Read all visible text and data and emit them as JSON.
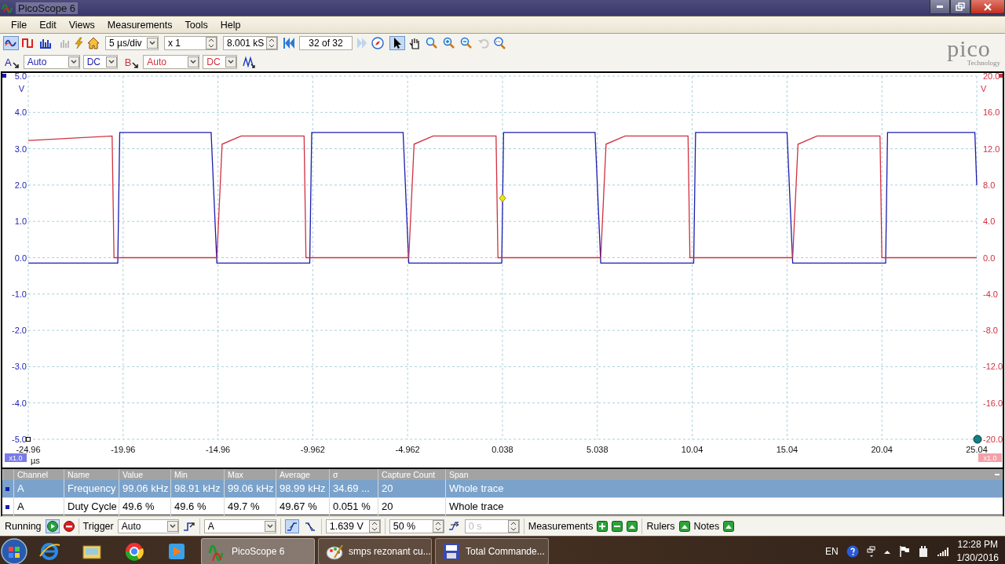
{
  "window": {
    "title": "PicoScope 6"
  },
  "menu": [
    {
      "label": "File"
    },
    {
      "label": "Edit"
    },
    {
      "label": "Views"
    },
    {
      "label": "Measurements"
    },
    {
      "label": "Tools"
    },
    {
      "label": "Help"
    }
  ],
  "toolbar": {
    "view_modes": [
      {
        "kind": "scope",
        "selected": true
      },
      {
        "kind": "persistence",
        "selected": false
      },
      {
        "kind": "spectrum",
        "selected": false
      }
    ],
    "timebase": "5 µs/div",
    "zoom": "x 1",
    "samples": "8.001 kS",
    "buffer": "32 of 32",
    "tools": [
      {
        "kind": "pointer",
        "selected": true
      },
      {
        "kind": "hand",
        "selected": false
      },
      {
        "kind": "zoom",
        "selected": false
      },
      {
        "kind": "zoom-in",
        "selected": false
      },
      {
        "kind": "zoom-out",
        "selected": false
      },
      {
        "kind": "undo",
        "selected": false
      }
    ]
  },
  "channels": [
    {
      "name": "A",
      "range": "Auto",
      "coupling": "DC",
      "color": "#1c1cb0"
    },
    {
      "name": "B",
      "range": "Auto",
      "coupling": "DC",
      "color": "#d03040"
    }
  ],
  "logo": {
    "name": "pico",
    "tagline": "Technology"
  },
  "scope": {
    "left_zoom": "x1.0",
    "right_zoom": "x1.0",
    "chart_data": {
      "type": "line",
      "xlabel": "µs",
      "ylabel": "V",
      "y2label": "V",
      "xlim": [
        -24.96,
        25.04
      ],
      "ylim": [
        -5,
        5
      ],
      "y2lim": [
        -20,
        20
      ],
      "xticks": [
        -24.96,
        -19.96,
        -14.96,
        -9.962,
        -4.962,
        0.038,
        5.038,
        10.04,
        15.04,
        20.04,
        25.04
      ],
      "yticks": [
        {
          "value": 5,
          "label": "5.0"
        },
        {
          "value": 4,
          "label": "4.0"
        },
        {
          "value": 3,
          "label": "3.0"
        },
        {
          "value": 2,
          "label": "2.0"
        },
        {
          "value": 1,
          "label": "1.0"
        },
        {
          "value": 0,
          "label": "0.0"
        },
        {
          "value": -1,
          "label": "-1.0"
        },
        {
          "value": -2,
          "label": "-2.0"
        },
        {
          "value": -3,
          "label": "-3.0"
        },
        {
          "value": -4,
          "label": "-4.0"
        },
        {
          "value": -5,
          "label": "-5.0"
        }
      ],
      "y2ticks": [
        {
          "value": 20,
          "label": "20.0"
        },
        {
          "value": 16,
          "label": "16.0"
        },
        {
          "value": 12,
          "label": "12.0"
        },
        {
          "value": 8,
          "label": "8.0"
        },
        {
          "value": 4,
          "label": "4.0"
        },
        {
          "value": 0,
          "label": "0.0"
        },
        {
          "value": -4,
          "label": "-4.0"
        },
        {
          "value": -8,
          "label": "-8.0"
        },
        {
          "value": -12,
          "label": "-12.0"
        },
        {
          "value": -16,
          "label": "-16.0"
        },
        {
          "value": -20,
          "label": "-20.0"
        }
      ],
      "x": [
        -24.96,
        -20.54,
        -20.44,
        -20.24,
        -20.14,
        -15.32,
        -15.02,
        -14.74,
        -13.74,
        -10.42,
        -10.32,
        -10.12,
        -10.02,
        -5.2,
        -4.9,
        -4.62,
        -3.62,
        -0.3,
        -0.2,
        0,
        0.1,
        4.92,
        5.22,
        5.5,
        6.5,
        9.82,
        9.92,
        10.12,
        10.22,
        15.04,
        15.34,
        15.62,
        16.62,
        19.94,
        20.04,
        20.24,
        20.34,
        24.94,
        25.04
      ],
      "series": [
        {
          "color": "#1c1cb0",
          "values": [
            -0.15,
            -0.15,
            -0.15,
            -0.15,
            3.45,
            3.45,
            -0.15,
            -0.15,
            -0.15,
            -0.15,
            -0.15,
            -0.15,
            3.45,
            3.45,
            -0.15,
            -0.15,
            -0.15,
            -0.15,
            -0.15,
            -0.15,
            3.45,
            3.45,
            -0.15,
            -0.15,
            -0.15,
            -0.15,
            -0.15,
            -0.15,
            3.45,
            3.45,
            -0.15,
            -0.15,
            -0.15,
            -0.15,
            -0.15,
            -0.15,
            3.45,
            3.45,
            2.0
          ]
        },
        {
          "color": "#d03040",
          "axis": "y2",
          "values": [
            12.9,
            13.4,
            0,
            0,
            0,
            0,
            0,
            12.5,
            13.4,
            13.4,
            0,
            0,
            0,
            0,
            0,
            12.5,
            13.4,
            13.4,
            0,
            0,
            0,
            0,
            0,
            12.5,
            13.4,
            13.4,
            0,
            0,
            0,
            0,
            0,
            12.5,
            13.4,
            13.4,
            0,
            0,
            0,
            0,
            0
          ]
        }
      ],
      "grid": true
    }
  },
  "measurements": {
    "columns": [
      "Channel",
      "Name",
      "Value",
      "Min",
      "Max",
      "Average",
      "σ",
      "Capture Count",
      "Span"
    ],
    "rows": [
      {
        "selected": true,
        "cells": [
          "A",
          "Frequency",
          "99.06 kHz",
          "98.91 kHz",
          "99.06 kHz",
          "98.99 kHz",
          "34.69 ...",
          "20",
          "Whole trace"
        ]
      },
      {
        "selected": false,
        "cells": [
          "A",
          "Duty Cycle",
          "49.6 %",
          "49.6 %",
          "49.7 %",
          "49.67 %",
          "0.051 %",
          "20",
          "Whole trace"
        ]
      }
    ]
  },
  "status_bar": {
    "run_state": "Running",
    "run_selected": true,
    "trigger_label": "Trigger",
    "trigger_mode": "Auto",
    "trigger_source": "A",
    "rising_selected": true,
    "falling_selected": false,
    "threshold": "1.639 V",
    "pretrigger": "50 %",
    "delay": "0 s",
    "delay_disabled": true,
    "measurements_label": "Measurements",
    "rulers_label": "Rulers",
    "notes_label": "Notes"
  },
  "taskbar": {
    "pinned": [
      {
        "kind": "browser"
      },
      {
        "kind": "folder"
      },
      {
        "kind": "chrome"
      },
      {
        "kind": "media"
      }
    ],
    "apps": [
      {
        "kind": "scope",
        "label": "PicoScope 6",
        "selected": true
      },
      {
        "kind": "paint",
        "label": "smps rezonant cu...",
        "selected": false
      },
      {
        "kind": "disk",
        "label": "Total Commande...",
        "selected": false
      }
    ],
    "language": "EN",
    "time": "12:28 PM",
    "date": "1/30/2016"
  }
}
